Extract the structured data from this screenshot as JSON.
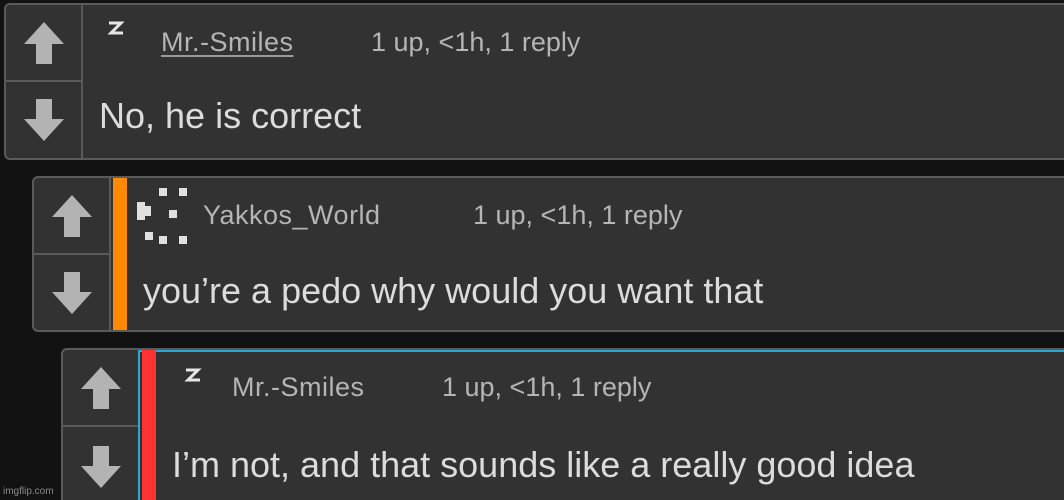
{
  "comments": [
    {
      "username": "Mr.-Smiles",
      "meta": "1 up, <1h, 1 reply",
      "text": "No, he is correct",
      "avatar_icon": "lightning-icon",
      "stripe_color": ""
    },
    {
      "username": "Yakkos_World",
      "meta": "1 up, <1h, 1 reply",
      "text": "you’re a pedo why would you want that",
      "avatar_icon": "pixel-pattern-icon",
      "stripe_color": "#ff8a00"
    },
    {
      "username": "Mr.-Smiles",
      "meta": "1 up, <1h, 1 reply",
      "text": "I’m not, and that sounds like a really good idea",
      "avatar_icon": "lightning-icon",
      "stripe_color": "#ff3333",
      "highlight_color": "#29a8d8"
    }
  ],
  "icons": {
    "upvote": "arrow-up-icon",
    "downvote": "arrow-down-icon"
  },
  "watermark": "imgflip.com"
}
